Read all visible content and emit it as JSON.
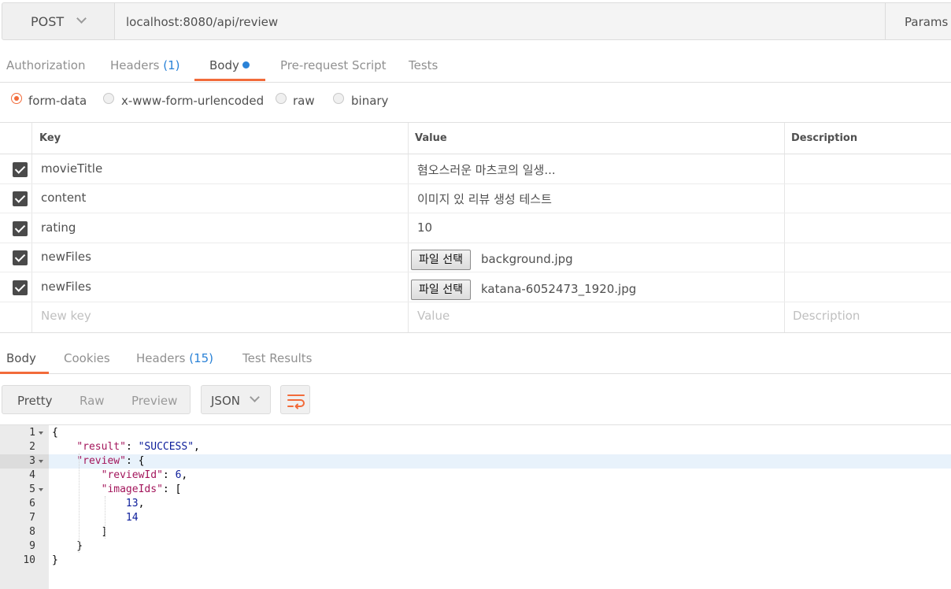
{
  "request": {
    "method": "POST",
    "url": "localhost:8080/api/review",
    "params_label": "Params"
  },
  "request_tabs": [
    {
      "label": "Authorization"
    },
    {
      "label": "Headers",
      "count": "(1)"
    },
    {
      "label": "Body",
      "active": true,
      "indicator": "blue-dot"
    },
    {
      "label": "Pre-request Script"
    },
    {
      "label": "Tests"
    }
  ],
  "body_types": [
    {
      "label": "form-data",
      "selected": true
    },
    {
      "label": "x-www-form-urlencoded",
      "selected": false
    },
    {
      "label": "raw",
      "selected": false
    },
    {
      "label": "binary",
      "selected": false
    }
  ],
  "form_table": {
    "headers": [
      "Key",
      "Value",
      "Description"
    ],
    "rows": [
      {
        "checked": true,
        "key": "movieTitle",
        "value": "혐오스러운 마츠코의 일생..."
      },
      {
        "checked": true,
        "key": "content",
        "value": "이미지 있 리뷰 생성 테스트"
      },
      {
        "checked": true,
        "key": "rating",
        "value": "10"
      },
      {
        "checked": true,
        "key": "newFiles",
        "file_button": "파일 선택",
        "file_name": "background.jpg"
      },
      {
        "checked": true,
        "key": "newFiles",
        "file_button": "파일 선택",
        "file_name": "katana-6052473_1920.jpg"
      }
    ],
    "placeholders": {
      "key": "New key",
      "value": "Value",
      "description": "Description"
    }
  },
  "response_tabs": [
    {
      "label": "Body",
      "active": true
    },
    {
      "label": "Cookies"
    },
    {
      "label": "Headers",
      "count": "(15)"
    },
    {
      "label": "Test Results"
    }
  ],
  "view_modes": [
    {
      "label": "Pretty",
      "active": true
    },
    {
      "label": "Raw"
    },
    {
      "label": "Preview"
    }
  ],
  "format": "JSON",
  "wrap_icon": "wrap-lines-icon",
  "editor": {
    "highlighted_line": 3,
    "lines": [
      {
        "n": "1",
        "fold": true,
        "tokens": [
          [
            "p",
            "{"
          ]
        ]
      },
      {
        "n": "2",
        "tokens": [
          [
            "p",
            "    "
          ],
          [
            "k",
            "\"result\""
          ],
          [
            "p",
            ": "
          ],
          [
            "s",
            "\"SUCCESS\""
          ],
          [
            "p",
            ","
          ]
        ]
      },
      {
        "n": "3",
        "fold": true,
        "tokens": [
          [
            "p",
            "    "
          ],
          [
            "k",
            "\"review\""
          ],
          [
            "p",
            ": {"
          ]
        ]
      },
      {
        "n": "4",
        "tokens": [
          [
            "p",
            "        "
          ],
          [
            "k",
            "\"reviewId\""
          ],
          [
            "p",
            ": "
          ],
          [
            "n",
            "6"
          ],
          [
            "p",
            ","
          ]
        ]
      },
      {
        "n": "5",
        "fold": true,
        "tokens": [
          [
            "p",
            "        "
          ],
          [
            "k",
            "\"imageIds\""
          ],
          [
            "p",
            ": ["
          ]
        ]
      },
      {
        "n": "6",
        "tokens": [
          [
            "p",
            "            "
          ],
          [
            "n",
            "13"
          ],
          [
            "p",
            ","
          ]
        ]
      },
      {
        "n": "7",
        "tokens": [
          [
            "p",
            "            "
          ],
          [
            "n",
            "14"
          ]
        ]
      },
      {
        "n": "8",
        "tokens": [
          [
            "p",
            "        ]"
          ]
        ]
      },
      {
        "n": "9",
        "tokens": [
          [
            "p",
            "    }"
          ]
        ]
      },
      {
        "n": "10",
        "tokens": [
          [
            "p",
            "}"
          ]
        ]
      }
    ]
  },
  "colors": {
    "accent": "#f26b3a",
    "count_blue": "#2a82d7",
    "json_key": "#a3155b",
    "json_value": "#0b1c9a"
  }
}
